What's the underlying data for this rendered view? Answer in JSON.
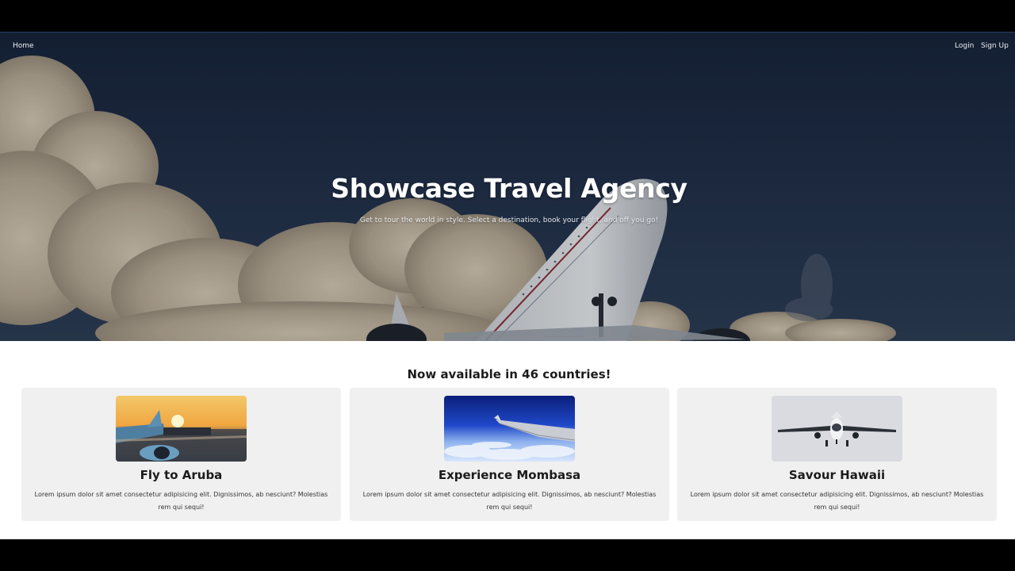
{
  "nav": {
    "home": "Home",
    "login": "Login",
    "signup": "Sign Up"
  },
  "hero": {
    "title": "Showcase Travel Agency",
    "subtitle": "Get to tour the world in style. Select a destination, book your flight, and off you go!"
  },
  "section": {
    "title": "Now available in 46 countries!"
  },
  "cards": [
    {
      "title": "Fly to Aruba",
      "text": "Lorem ipsum dolor sit amet consectetur adipisicing elit. Dignissimos, ab nesciunt? Molestias rem qui sequi!"
    },
    {
      "title": "Experience Mombasa",
      "text": "Lorem ipsum dolor sit amet consectetur adipisicing elit. Dignissimos, ab nesciunt? Molestias rem qui sequi!"
    },
    {
      "title": "Savour Hawaii",
      "text": "Lorem ipsum dolor sit amet consectetur adipisicing elit. Dignissimos, ab nesciunt? Molestias rem qui sequi!"
    }
  ]
}
